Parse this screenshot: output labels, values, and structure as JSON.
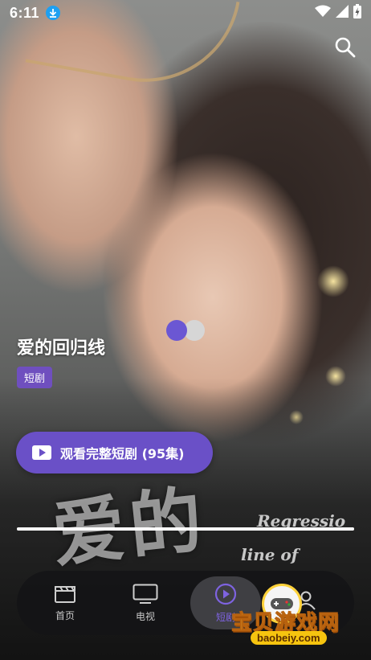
{
  "status_bar": {
    "time": "6:11",
    "icons": [
      "download-notification-icon",
      "wifi-icon",
      "cellular-signal-icon",
      "battery-charging-icon"
    ]
  },
  "header": {
    "search_icon": "search-icon"
  },
  "poster_overlay": {
    "chinese": "爱的",
    "english_line1": "Regressio",
    "english_line2": "line of"
  },
  "drama": {
    "title": "爱的回归线",
    "tag": "短剧",
    "watch_button_label": "观看完整短剧 (95集)"
  },
  "playback": {
    "progress_fraction": 1.0
  },
  "bottom_nav": {
    "items": [
      {
        "label": "首页",
        "icon": "clapperboard-icon"
      },
      {
        "label": "电视",
        "icon": "tv-icon"
      },
      {
        "label": "短剧",
        "icon": "play-circle-icon",
        "active": true
      },
      {
        "label": "",
        "icon": "user-icon"
      }
    ]
  },
  "watermark": {
    "name": "宝贝游戏网",
    "url": "baobeiy.com"
  },
  "colors": {
    "accent": "#6a50c7",
    "tag_bg": "#6f4fbf",
    "active_nav": "#7e63e0",
    "loader_dot": "#6b57d3"
  }
}
